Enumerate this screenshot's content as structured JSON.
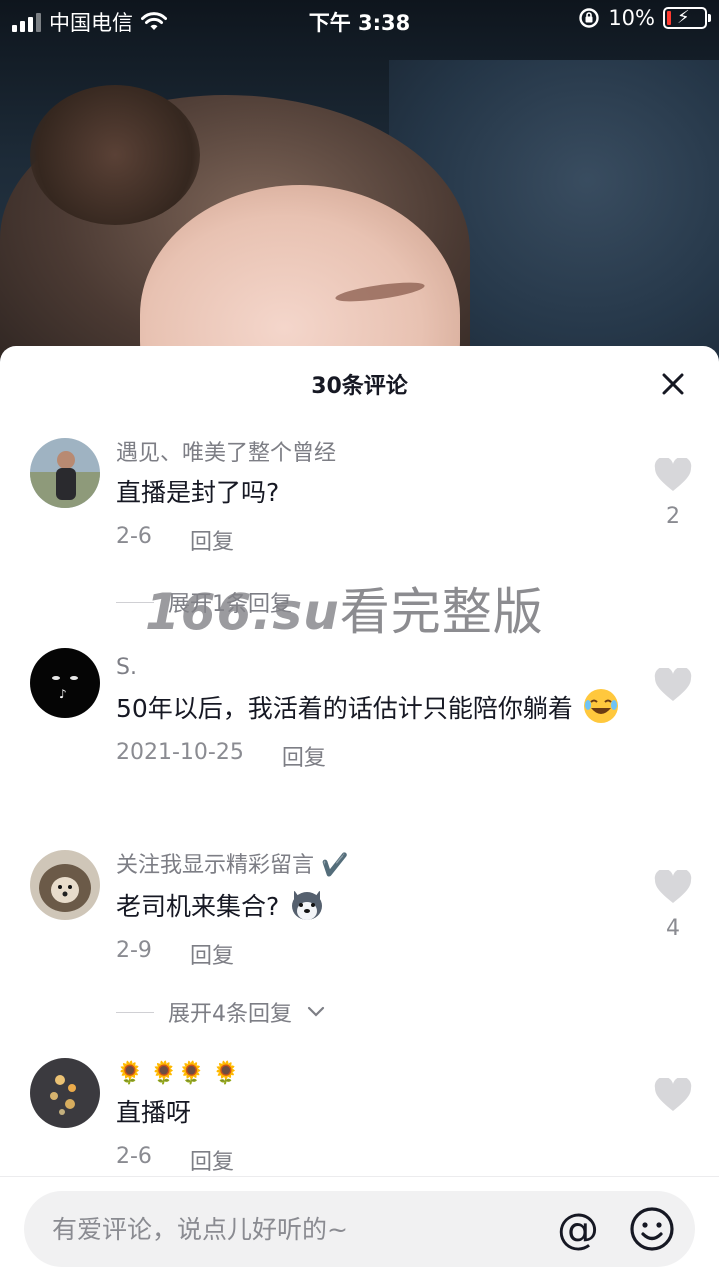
{
  "status_bar": {
    "carrier": "中国电信",
    "time": "下午 3:38",
    "battery": "10%",
    "icons": [
      "signal-icon",
      "wifi-icon",
      "rotation-lock-icon",
      "battery-charging-icon"
    ]
  },
  "sheet": {
    "title": "30条评论",
    "close_icon": "close-icon"
  },
  "comments": [
    {
      "username": "遇见、唯美了整个曾经",
      "text": "直播是封了吗?",
      "date": "2-6",
      "reply_label": "回复",
      "likes": "2",
      "expand_label": "展开1条回复"
    },
    {
      "username": "S.",
      "text": "50年以后，我活着的话估计只能陪你躺着",
      "emoji": "laughing-crying-emoji",
      "date": "2021-10-25",
      "reply_label": "回复",
      "likes": ""
    },
    {
      "username": "关注我显示精彩留言 ✔️",
      "text": "老司机来集合?",
      "emoji": "husky-dog-emoji",
      "date": "2-9",
      "reply_label": "回复",
      "likes": "4",
      "expand_label": "展开4条回复"
    },
    {
      "username": "🌻  🌻🌻  🌻",
      "text": "直播呀",
      "date": "2-6",
      "reply_label": "回复",
      "likes": ""
    }
  ],
  "watermark": {
    "brand": "166.su",
    "text": "看完整版"
  },
  "input": {
    "placeholder": "有爱评论，说点儿好听的~",
    "at_symbol": "@"
  },
  "colors": {
    "like_heart": "#d7d7da",
    "text_primary": "#161823",
    "text_secondary": "#7d7e85",
    "battery_low": "#ff3b30"
  }
}
